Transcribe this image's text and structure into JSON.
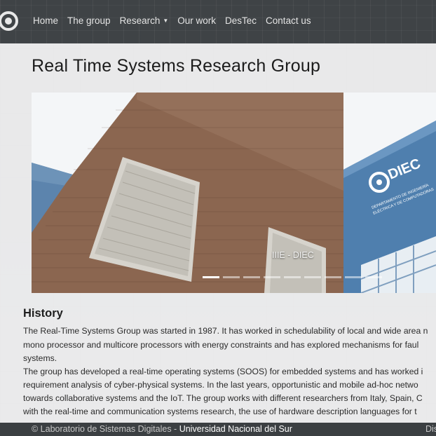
{
  "nav": {
    "items": [
      "Home",
      "The group",
      "Research",
      "Our work",
      "DesTec",
      "Contact us"
    ]
  },
  "page": {
    "title": "Real Time Systems Research Group"
  },
  "carousel": {
    "caption": "IIIE - DIEC",
    "sign_text": "DIEC",
    "sign_subtext_1": "DEPARTAMENTO DE INGENIERÍA",
    "sign_subtext_2": "ELÉCTRICA Y DE COMPUTADORAS",
    "slide_count": 9,
    "active_slide": 1
  },
  "history": {
    "heading": "History",
    "lines": [
      "The Real-Time Systems Group was started in 1987. It has worked in schedulability of local and wide area n",
      "mono processor and multicore processors with energy constraints and has explored mechanisms for faul",
      "systems.",
      "The group has developed a real-time operating systems (SOOS) for embedded systems and has worked i",
      "requirement analysis of cyber-physical systems. In the last years, opportunistic and mobile ad-hoc netwo",
      "towards collaborative systems and the IoT. The group works with different researchers from Italy, Spain, C",
      "with the real-time and communication systems research, the use of hardware description languages for t"
    ]
  },
  "footer": {
    "copyright": "© Laboratorio de Sistemas Digitales - ",
    "university": "Universidad Nacional del Sur",
    "right_text": "Dis"
  },
  "colors": {
    "navbar": "#3f4346",
    "footer": "#3b3f42",
    "building_brick": "#8b6650",
    "building_blue": "#4f7fae"
  }
}
